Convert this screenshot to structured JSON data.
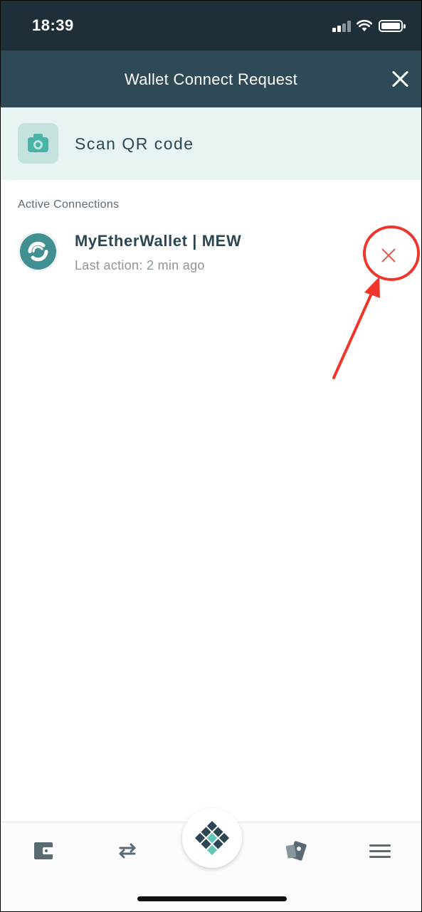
{
  "status_bar": {
    "time": "18:39"
  },
  "header": {
    "title": "Wallet Connect Request",
    "close_icon": "close-icon"
  },
  "scan": {
    "label": "Scan QR code",
    "icon": "camera-icon"
  },
  "active_connections": {
    "section_label": "Active Connections",
    "items": [
      {
        "name": "MyEtherWallet | MEW",
        "last_action": "Last action: 2 min ago",
        "icon": "mew-logo"
      }
    ]
  },
  "bottom_nav": {
    "items": [
      {
        "icon": "wallet-icon"
      },
      {
        "icon": "swap-icon"
      },
      {
        "icon": "home-diamond-icon"
      },
      {
        "icon": "cards-icon"
      },
      {
        "icon": "menu-icon"
      }
    ]
  },
  "colors": {
    "status_bar_bg": "#1f2f3a",
    "header_bg": "#2e4a57",
    "scan_row_bg": "#e7f4f3",
    "accent_teal": "#49b3a6",
    "disconnect_red": "#e25b4d",
    "annotation_red": "#f0362b"
  }
}
